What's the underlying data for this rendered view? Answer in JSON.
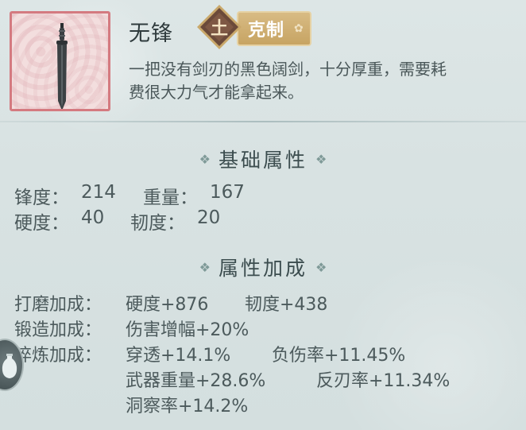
{
  "item": {
    "name": "无锋",
    "element_char": "土",
    "counter_label": "克制",
    "description_lines": [
      "一把没有剑刃的黑色阔剑，十分厚重，需要耗",
      "费很大力气才能拿起来。"
    ]
  },
  "basic": {
    "title": "基础属性",
    "stats": [
      {
        "label": "锋度：",
        "value": "214"
      },
      {
        "label": "重量：",
        "value": "167"
      },
      {
        "label": "硬度：",
        "value": "40"
      },
      {
        "label": "韧度：",
        "value": "20"
      }
    ]
  },
  "bonus": {
    "title": "属性加成",
    "rows": [
      {
        "label": "打磨加成：",
        "values": [
          "硬度+876",
          "韧度+438"
        ]
      },
      {
        "label": "锻造加成：",
        "values": [
          "伤害增幅+20%"
        ]
      },
      {
        "label": "淬炼加成：",
        "values": [
          "穿透+14.1%",
          "负伤率+11.45%"
        ]
      },
      {
        "label": "",
        "values": [
          "武器重量+28.6%",
          "反刃率+11.34%"
        ]
      },
      {
        "label": "",
        "values": [
          "洞察率+14.2%"
        ]
      }
    ]
  },
  "colors": {
    "frame_border": "#d47a80",
    "pill": "#c7a463",
    "badge": "#6b4a3a"
  },
  "icons": {
    "item": "black-broadsword-icon",
    "element": "earth-element-icon",
    "section": "diamond-ornament-icon",
    "side": "vase-icon"
  }
}
